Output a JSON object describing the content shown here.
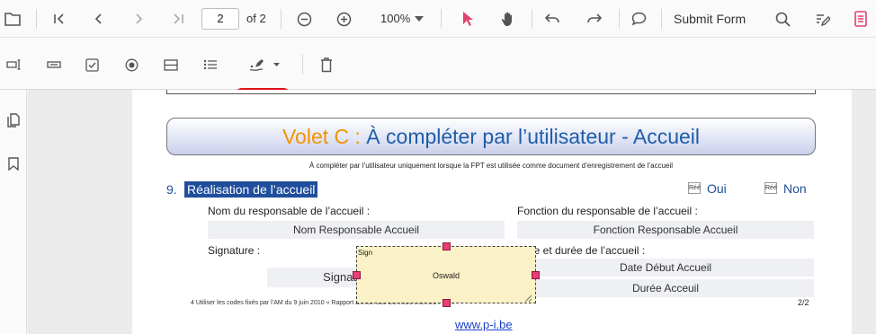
{
  "toolbar": {
    "page_number": "2",
    "page_total": "of 2",
    "zoom": "100%",
    "submit_form_label": "Submit Form"
  },
  "form_toolbar": {
    "selected_tool": "signature-field"
  },
  "document": {
    "section_title_prefix": "Volet C : ",
    "section_title_rest": "À compléter par l’utilisateur - Accueil",
    "subtitle": "À compléter par l’utilisateur uniquement lorsque la FPT est utilisée comme document d’enregistrement de l’accueil",
    "item_number": "9.",
    "item_title": "Réalisation de l’accueil",
    "oui_label": "Oui",
    "non_label": "Non",
    "checkbox_tag": "Réé",
    "nom_label": "Nom du responsable de l’accueil :",
    "nom_value": "Nom Responsable Accueil",
    "fonction_label": "Fonction du responsable de l’accueil :",
    "fonction_value": "Fonction Responsable Accueil",
    "signature_label": "Signature :",
    "signature_field_text": "Signature",
    "date_label": "Date et durée de l’accueil :",
    "date_value": "Date Début Accueil",
    "duree_value": "Durée Acceuil",
    "footnote": "4 Utiliser les codes fixés par l’AM du 9 juin 2010 « Rapport annuel des Services internes PPT »",
    "page_indicator": "2/2",
    "website": "www.p-i.be"
  },
  "sign_annotation": {
    "label": "Sign",
    "value": "Oswald"
  },
  "colors": {
    "accent": "#e0416e",
    "title_orange": "#f29400",
    "title_blue": "#1f5ea8",
    "item_bg": "#1f4e9c",
    "highlight_red": "#e0131c"
  }
}
